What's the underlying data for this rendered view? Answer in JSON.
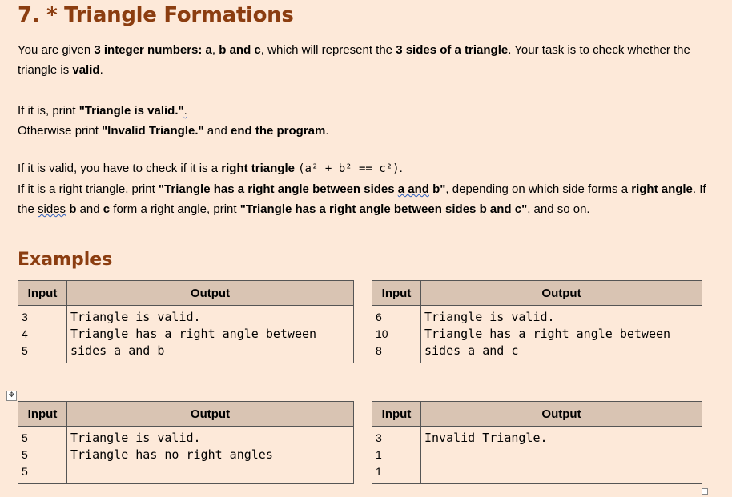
{
  "title": "7. * Triangle Formations",
  "para1": {
    "t1": "You are given ",
    "b1": "3 integer numbers: a",
    "t2": ", ",
    "b2": "b",
    "t3": " ",
    "b3": "and c",
    "t4": ", which will represent the ",
    "b4": "3 sides of a triangle",
    "t5": ". Your task is to check whether the triangle is ",
    "b5": "valid",
    "t6": "."
  },
  "para2": {
    "l1_t1": "If it is, print ",
    "l1_b1": "\"Triangle is valid.\"",
    "l1_t2": ".",
    "l2_t1": "Otherwise print ",
    "l2_b1": "\"Invalid Triangle.\"",
    "l2_t2": " and ",
    "l2_b2": "end the program",
    "l2_t3": "."
  },
  "para3": {
    "t1": "If it is valid, you have to check if it is a ",
    "b1": "right triangle",
    "t2": " ",
    "formula": "(a² + b² == c²)",
    "t3": ".",
    "t4": "If it is a right triangle, print ",
    "b2": "\"Triangle has a right angle between sides ",
    "b2w": "a and",
    "b3": " b\"",
    "t5": ", depending on which side forms a ",
    "b4": "right angle",
    "t6": ". If the ",
    "t6w": "sides",
    "t7": " ",
    "b5": "b",
    "t8": " and ",
    "b6": "c",
    "t9": " form a right angle, print ",
    "b7": "\"Triangle has a right angle between sides b and c\"",
    "t10": ", and so on."
  },
  "examples_title": "Examples",
  "tables": [
    {
      "input_header": "Input",
      "output_header": "Output",
      "input": [
        "3",
        "4",
        "5"
      ],
      "output": [
        "Triangle is valid.",
        "Triangle has a right angle between",
        "sides a and b"
      ]
    },
    {
      "input_header": "Input",
      "output_header": "Output",
      "input": [
        "6",
        "10",
        "8"
      ],
      "output": [
        "Triangle is valid.",
        "Triangle has a right angle between",
        "sides a and c"
      ]
    },
    {
      "input_header": "Input",
      "output_header": "Output",
      "input": [
        "5",
        "5",
        "5"
      ],
      "output": [
        "Triangle is valid.",
        "Triangle has no right angles"
      ]
    },
    {
      "input_header": "Input",
      "output_header": "Output",
      "input": [
        "3",
        "1",
        "1"
      ],
      "output": [
        "Invalid Triangle."
      ]
    }
  ],
  "icons": {
    "table_move": "move-handle-icon",
    "table_resize": "resize-handle-icon"
  }
}
